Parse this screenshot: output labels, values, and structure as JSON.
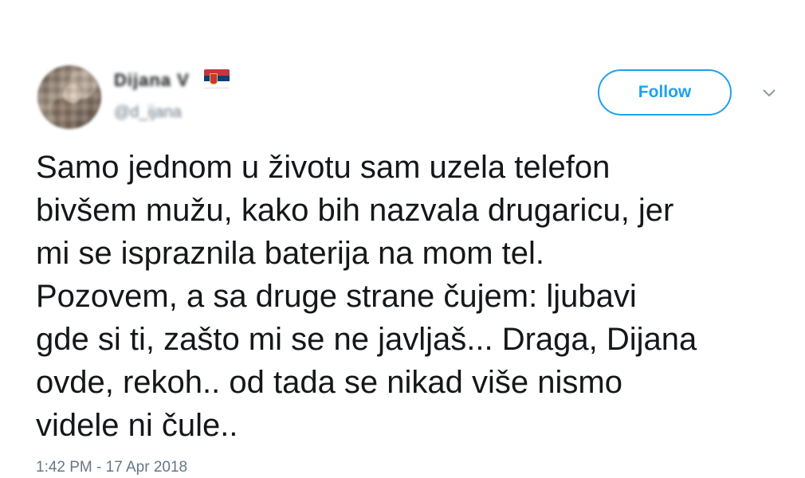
{
  "tweet": {
    "author": {
      "display_name": "Dijana V",
      "handle": "@d_ijana",
      "avatar_icon": "user-avatar",
      "flag_icon": "serbia-flag-icon"
    },
    "follow_label": "Follow",
    "menu_icon": "chevron-down-icon",
    "text_lines": [
      "Samo jednom u životu sam uzela telefon",
      "bivšem mužu, kako bih nazvala drugaricu, jer",
      "mi se ispraznila baterija na mom tel.",
      "Pozovem, a sa druge strane čujem: ljubavi",
      "gde si ti, zašto mi se ne javljaš... Draga, Dijana",
      "ovde, rekoh.. od tada se nikad više nismo",
      "videle ni čule.."
    ],
    "timestamp": "1:42 PM - 17 Apr 2018"
  },
  "colors": {
    "accent": "#1da1f2",
    "text": "#14171a",
    "muted": "#657786"
  }
}
